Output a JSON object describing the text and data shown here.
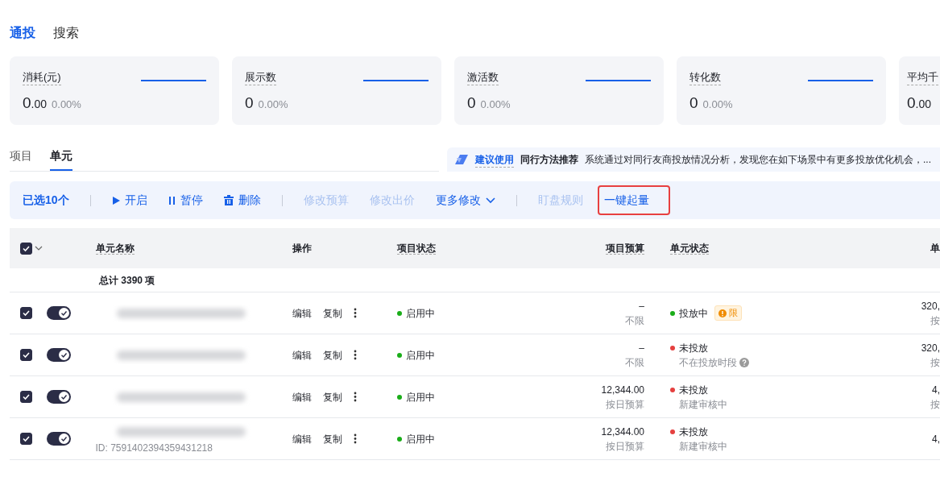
{
  "top_tabs": [
    {
      "label": "通投",
      "selected": true
    },
    {
      "label": "搜索",
      "selected": false
    }
  ],
  "metrics": [
    {
      "label": "消耗(元)",
      "value": "0",
      "decimals": ".00",
      "change": "0.00%",
      "sparkline": true
    },
    {
      "label": "展示数",
      "value": "0",
      "change": "0.00%",
      "sparkline": true
    },
    {
      "label": "激活数",
      "value": "0",
      "change": "0.00%",
      "sparkline": true
    },
    {
      "label": "转化数",
      "value": "0",
      "change": "0.00%",
      "sparkline": true
    },
    {
      "label": "平均千",
      "value": "0",
      "decimals": ".00",
      "sparkline": false
    }
  ],
  "sub_tabs": [
    {
      "label": "项目",
      "selected": false
    },
    {
      "label": "单元",
      "selected": true
    }
  ],
  "recommendation": {
    "badge": "建议使用",
    "title": "同行方法推荐",
    "text": "系统通过对同行友商投放情况分析，发现您在如下场景中有更多投放优化机会，..."
  },
  "toolbar": {
    "selected_count": "已选10个",
    "actions": [
      {
        "kind": "separator"
      },
      {
        "kind": "play",
        "label": "开启",
        "disabled": false,
        "highlighted": false
      },
      {
        "kind": "pause",
        "label": "暂停",
        "disabled": false,
        "highlighted": false
      },
      {
        "kind": "trash",
        "label": "删除",
        "disabled": false,
        "highlighted": false
      },
      {
        "kind": "separator"
      },
      {
        "kind": "plain",
        "label": "修改预算",
        "disabled": true,
        "highlighted": false
      },
      {
        "kind": "plain",
        "label": "修改出价",
        "disabled": true,
        "highlighted": false
      },
      {
        "kind": "dropdown",
        "label": "更多修改",
        "disabled": false,
        "highlighted": false
      },
      {
        "kind": "separator"
      },
      {
        "kind": "plain",
        "label": "盯盘规则",
        "disabled": true,
        "highlighted": false
      },
      {
        "kind": "plain",
        "label": "一键起量",
        "disabled": false,
        "highlighted": true
      }
    ]
  },
  "table": {
    "select_all": {
      "checked": true
    },
    "columns": [
      "单元名称",
      "操作",
      "项目状态",
      "项目预算",
      "单元状态",
      "单"
    ],
    "total": "总计 3390 项",
    "rows": [
      {
        "checked": true,
        "on": true,
        "actions": [
          "编辑",
          "复制"
        ],
        "project_status": {
          "label": "启用中",
          "color": "#1aad19"
        },
        "budget": "–",
        "budget_note": "不限",
        "unit_status": {
          "label": "投放中",
          "color": "#1aad19"
        },
        "limit_tag": "限",
        "column_6": "320,",
        "column_6_note": "按"
      },
      {
        "checked": true,
        "on": true,
        "actions": [
          "编辑",
          "复制"
        ],
        "project_status": {
          "label": "启用中",
          "color": "#1aad19"
        },
        "budget": "–",
        "budget_note": "不限",
        "unit_status": {
          "label": "未投放",
          "color": "#e5403f"
        },
        "unit_note": "不在投放时段",
        "help": true,
        "column_6": "320,",
        "column_6_note": "按"
      },
      {
        "checked": true,
        "on": true,
        "actions": [
          "编辑",
          "复制"
        ],
        "project_status": {
          "label": "启用中",
          "color": "#1aad19"
        },
        "budget": "12,344.00",
        "budget_note": "按日预算",
        "unit_status": {
          "label": "未投放",
          "color": "#e5403f"
        },
        "unit_note": "新建审核中",
        "column_6": "4,",
        "column_6_note": "按"
      },
      {
        "checked": true,
        "on": true,
        "id": "ID: 7591402394359431218",
        "actions": [
          "编辑",
          "复制"
        ],
        "project_status": {
          "label": "启用中",
          "color": "#1aad19"
        },
        "budget": "12,344.00",
        "budget_note": "按日预算",
        "unit_status": {
          "label": "未投放",
          "color": "#e5403f"
        },
        "unit_note": "新建审核中",
        "column_6": "4,"
      }
    ]
  }
}
